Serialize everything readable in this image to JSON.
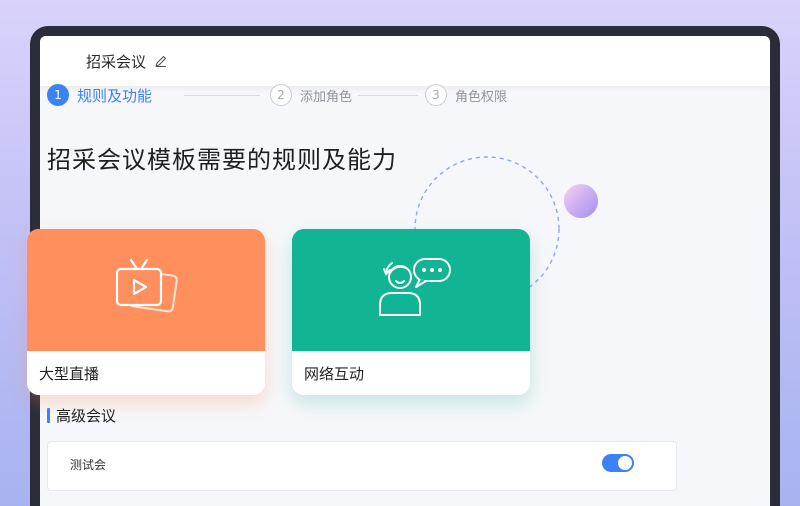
{
  "header": {
    "title": "招采会议"
  },
  "steps": [
    {
      "num": "1",
      "label": "规则及功能",
      "active": true
    },
    {
      "num": "2",
      "label": "添加角色",
      "active": false
    },
    {
      "num": "3",
      "label": "角色权限",
      "active": false
    }
  ],
  "main": {
    "heading": "招采会议模板需要的规则及能力",
    "cards": [
      {
        "label": "大型直播",
        "icon": "tv-icon",
        "color": "#ff8f5d"
      },
      {
        "label": "网络互动",
        "icon": "user-chat-icon",
        "color": "#12b593"
      }
    ]
  },
  "section": {
    "title": "高级会议",
    "rows": [
      {
        "label": "测试会",
        "enabled": true
      }
    ]
  },
  "colors": {
    "accent": "#3b82f6",
    "orange": "#ff8f5d",
    "green": "#12b593"
  }
}
